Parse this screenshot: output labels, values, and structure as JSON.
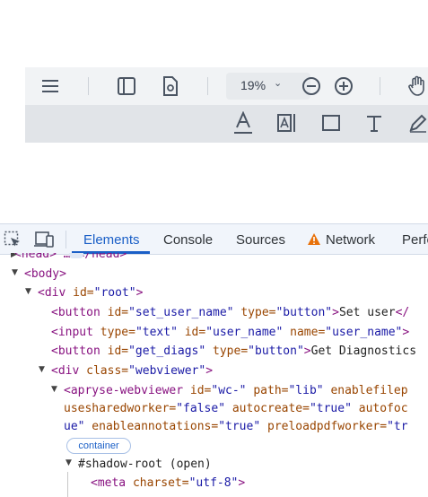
{
  "viewer": {
    "zoom": "19%",
    "icons": [
      "menu-icon",
      "sidebar-panel-icon",
      "document-settings-icon",
      "zoom-out-icon",
      "zoom-in-icon",
      "pan-hand-icon"
    ],
    "annotation_tools": [
      "underline-text-icon",
      "free-text-icon",
      "rectangle-icon",
      "text-icon",
      "pen-icon"
    ]
  },
  "devtools": {
    "tabs": {
      "elements": "Elements",
      "console": "Console",
      "sources": "Sources",
      "network": "Network",
      "performance": "Perfo"
    },
    "active_tab": "Elements",
    "accent": "#1a5fc7"
  },
  "tree": {
    "head_line": "<head> … </head>",
    "body_open": "<body>",
    "div_root": {
      "tag": "<div ",
      "attr": "id=",
      "val": "\"root\"",
      "close": ">"
    },
    "button1": {
      "open": "<button ",
      "a1": "id=",
      "v1": "\"set_user_name\"",
      "a2": " type=",
      "v2": "\"button\"",
      "close": ">",
      "text": "Set user",
      "end": "</"
    },
    "input1": {
      "open": "<input ",
      "a1": "type=",
      "v1": "\"text\"",
      "a2": " id=",
      "v2": "\"user_name\"",
      "a3": " name=",
      "v3": "\"user_name\"",
      "close": ">"
    },
    "button2": {
      "open": "<button ",
      "a1": "id=",
      "v1": "\"get_diags\"",
      "a2": " type=",
      "v2": "\"button\"",
      "close": ">",
      "text": "Get Diagnostics"
    },
    "div_webviewer": {
      "open": "<div ",
      "a1": "class=",
      "v1": "\"webviewer\"",
      "close": ">"
    },
    "apryse": {
      "line1": {
        "open": "<apryse-webviewer ",
        "a1": "id=",
        "v1": "\"wc-\"",
        "a2": " path=",
        "v2": "\"lib\"",
        "a3": " enablefilep"
      },
      "line2": {
        "a1": "usesharedworker=",
        "v1": "\"false\"",
        "a2": " autocreate=",
        "v2": "\"true\"",
        "a3": " autofoc"
      },
      "line3": {
        "v0": "ue\"",
        "a1": " enableannotations=",
        "v1": "\"true\"",
        "a2": " preloadpdfworker=",
        "v2": "\"tr"
      }
    },
    "badge": "container",
    "shadow_root": "#shadow-root (open)",
    "meta": {
      "open": "<meta ",
      "a1": "charset=",
      "v1": "\"utf-8\"",
      "close": ">"
    }
  }
}
